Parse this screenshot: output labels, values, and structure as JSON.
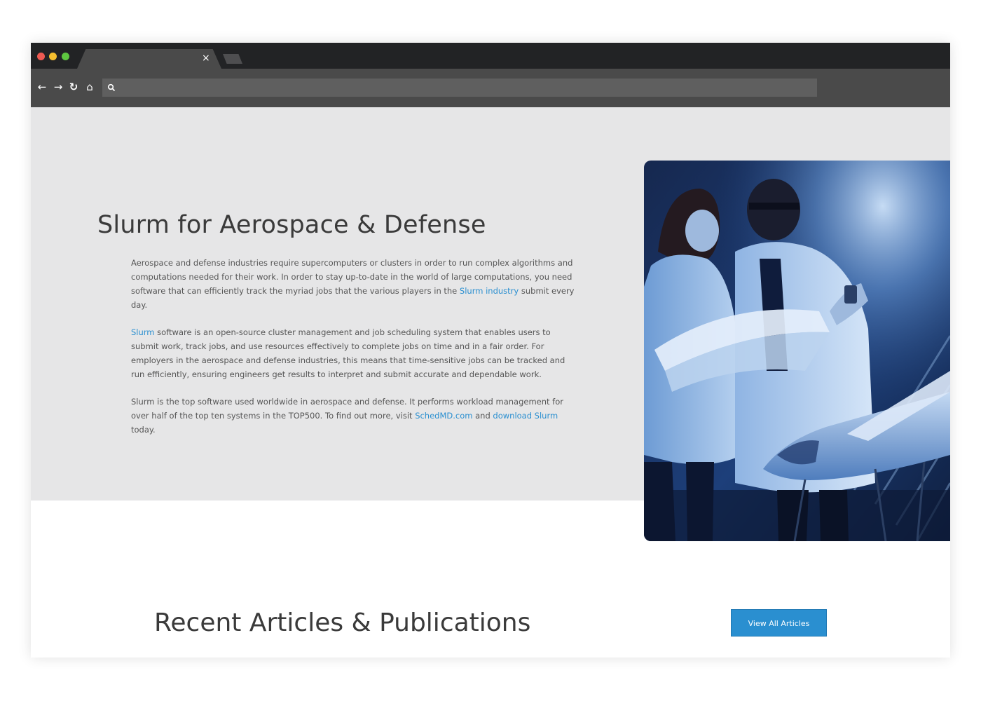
{
  "browser": {
    "tab_close_glyph": "×",
    "nav": {
      "back_glyph": "←",
      "forward_glyph": "→",
      "reload_glyph": "↻",
      "home_glyph": "⌂"
    },
    "address_value": "",
    "icons": [
      "search-icon",
      "back-arrow-icon",
      "forward-arrow-icon",
      "reload-icon",
      "home-icon",
      "close-icon"
    ],
    "traffic_colors": [
      "#ee5a52",
      "#f5be2f",
      "#5ec640"
    ]
  },
  "hero": {
    "title": "Slurm for Aerospace & Defense",
    "paragraphs": [
      {
        "before": "Aerospace and defense industries require supercomputers or clusters in order to run complex algorithms and computations needed for their work. In order to stay up-to-date in the world of large computations, you need software that can efficiently track the myriad jobs that the various players in the ",
        "link": "Slurm industry",
        "after": " submit every day."
      },
      {
        "link": "Slurm",
        "after": " software is an open-source cluster management and job scheduling system that enables users to submit work, track jobs, and use resources effectively to complete jobs on time and in a fair order. For employers in the aerospace and defense industries, this means that time-sensitive jobs can be tracked and run efficiently, ensuring engineers get results to interpret and submit accurate and dependable work."
      },
      {
        "before": "Slurm is the top software used worldwide in aerospace and defense. It performs workload management for over half of the top ten systems in the TOP500. To find out more, visit ",
        "link1": "SchedMD.com",
        "middle": " and ",
        "link2": "download Slurm",
        "after": " today."
      }
    ],
    "image_alt": "engineers-inspecting-aircraft-model-photo"
  },
  "articles": {
    "title": "Recent Articles & Publications",
    "button_label": "View All Articles"
  },
  "colors": {
    "accent": "#2a8fd0",
    "hero_bg": "#e6e6e7",
    "heading": "#3a3a3a",
    "body_text": "#555555"
  }
}
